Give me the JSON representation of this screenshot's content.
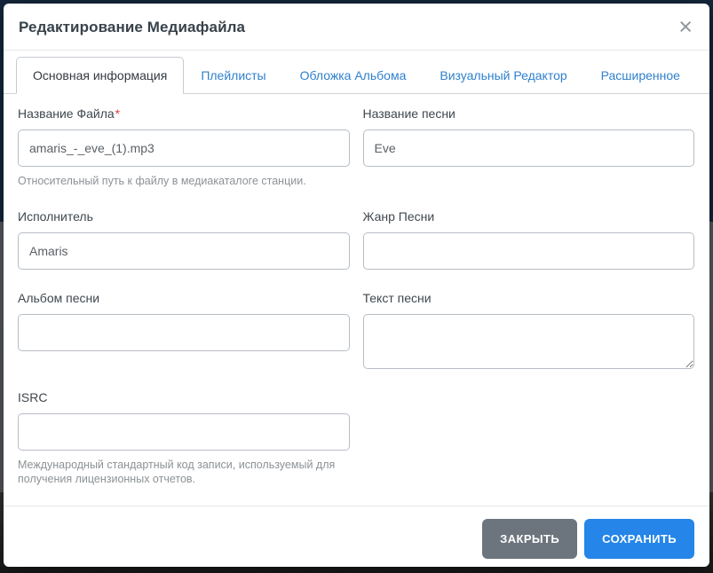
{
  "modal": {
    "title": "Редактирование Медиафайла",
    "close_glyph": "×"
  },
  "tabs": [
    {
      "label": "Основная информация",
      "active": true
    },
    {
      "label": "Плейлисты",
      "active": false
    },
    {
      "label": "Обложка Альбома",
      "active": false
    },
    {
      "label": "Визуальный Редактор",
      "active": false
    },
    {
      "label": "Расширенное",
      "active": false
    }
  ],
  "form": {
    "file_name": {
      "label": "Название Файла",
      "required_marker": "*",
      "value": "amaris_-_eve_(1).mp3",
      "help": "Относительный путь к файлу в медиакаталоге станции."
    },
    "song_title": {
      "label": "Название песни",
      "value": "Eve"
    },
    "artist": {
      "label": "Исполнитель",
      "value": "Amaris"
    },
    "genre": {
      "label": "Жанр Песни",
      "value": ""
    },
    "album": {
      "label": "Альбом песни",
      "value": ""
    },
    "lyrics": {
      "label": "Текст песни",
      "value": ""
    },
    "isrc": {
      "label": "ISRC",
      "value": "",
      "help": "Международный стандартный код записи, используемый для получения лицензионных отчетов."
    }
  },
  "footer": {
    "close_label": "ЗАКРЫТЬ",
    "save_label": "СОХРАНИТЬ"
  },
  "colors": {
    "primary_blue": "#2585e8",
    "secondary_gray": "#6c757d",
    "tab_link_blue": "#2f80cd",
    "required_red": "#e53935",
    "backdrop_navy": "#14273b"
  }
}
